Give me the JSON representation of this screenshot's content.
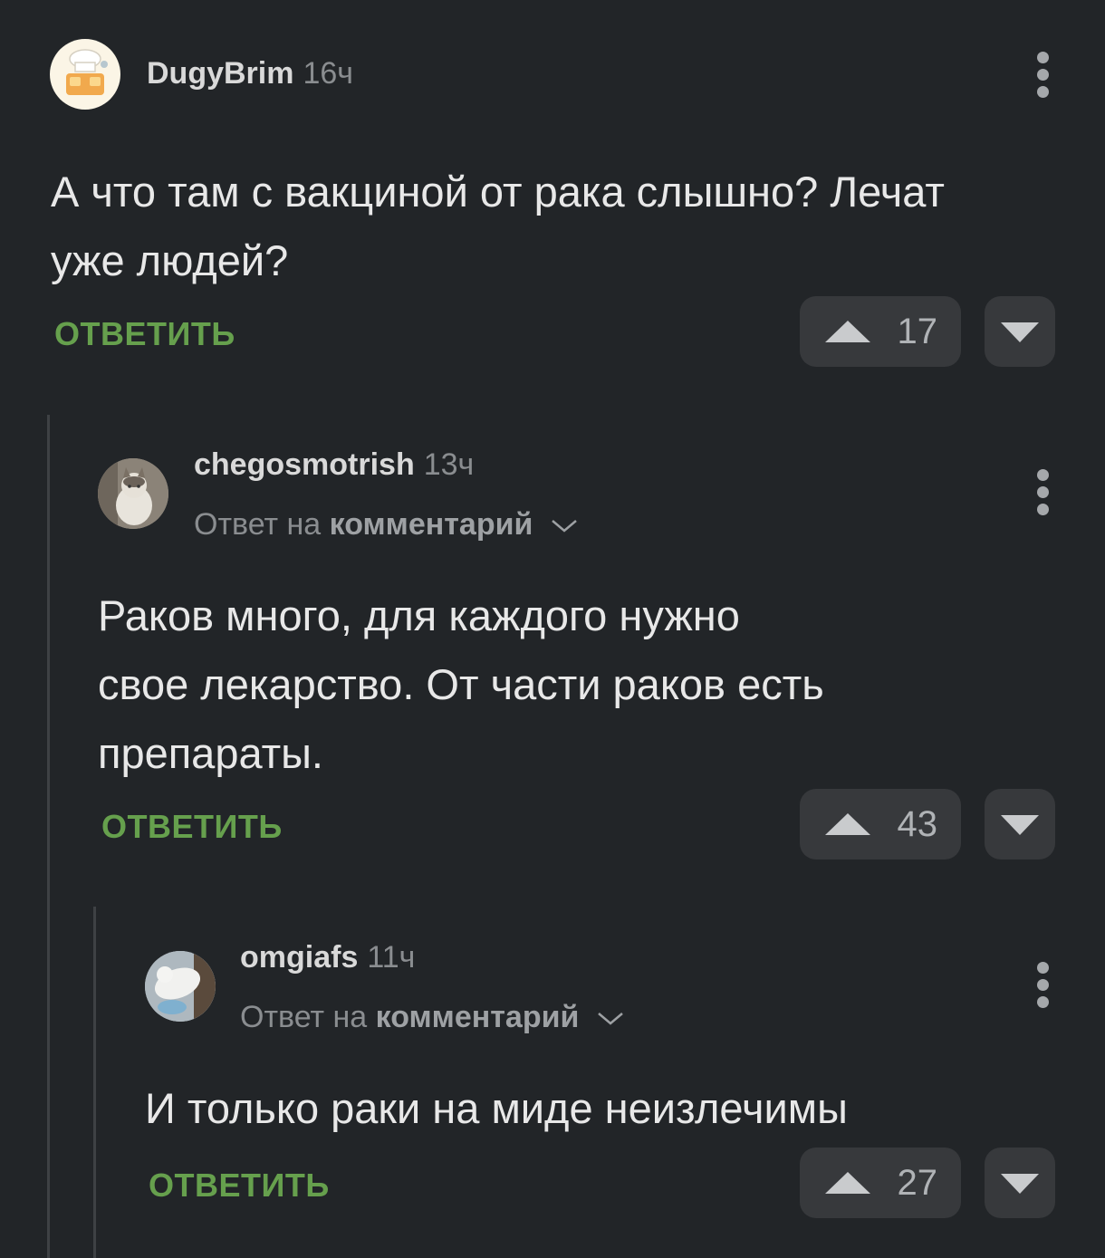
{
  "comments": [
    {
      "username": "DugyBrim",
      "time": "16ч",
      "text_lines": [
        "А что там с вакциной от рака слышно? Лечат",
        "уже людей?"
      ],
      "reply_label": "ОТВЕТИТЬ",
      "upvotes": "17"
    },
    {
      "username": "chegosmotrish",
      "time": "13ч",
      "reply_prefix": "Ответ на",
      "reply_target": "комментарий",
      "text_lines": [
        "Раков много, для каждого нужно",
        "свое лекарство. От части раков есть",
        "препараты."
      ],
      "reply_label": "ОТВЕТИТЬ",
      "upvotes": "43"
    },
    {
      "username": "omgiafs",
      "time": "11ч",
      "reply_prefix": "Ответ на",
      "reply_target": "комментарий",
      "text_lines": [
        "И только раки на миде неизлечимы"
      ],
      "reply_label": "ОТВЕТИТЬ",
      "upvotes": "27"
    }
  ],
  "colors": {
    "background": "#222528",
    "reply_accent": "#66a04d",
    "vote_button": "#37393c"
  },
  "icons": [
    "more-icon",
    "upvote-icon",
    "downvote-icon",
    "chevron-down-icon"
  ]
}
